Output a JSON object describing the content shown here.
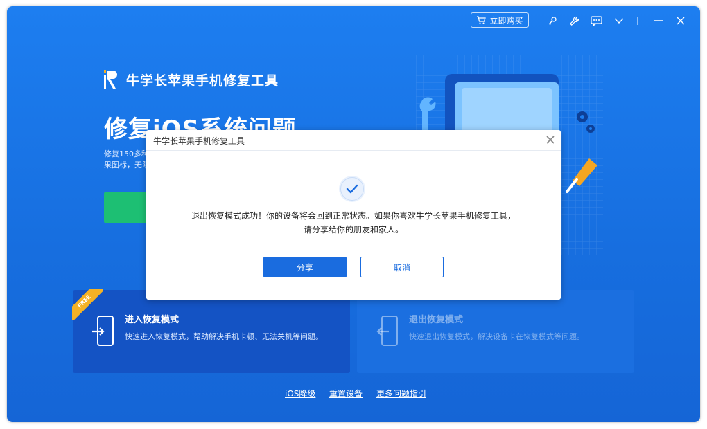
{
  "window": {
    "buy_button_label": "立即购买",
    "icons": [
      "key-icon",
      "wrench-icon",
      "feedback-icon",
      "chevron-down-icon",
      "minimize-icon",
      "close-icon"
    ]
  },
  "brand": {
    "name": "牛学长苹果手机修复工具",
    "logo_letter": "R"
  },
  "hero": {
    "title": "修复iOS系统问题",
    "desc_line1": "修复150多种",
    "desc_line2": "果图标，无限"
  },
  "cards": {
    "enter": {
      "badge": "FREE",
      "title": "进入恢复模式",
      "desc": "快速进入恢复模式，帮助解决手机卡顿、无法关机等问题。"
    },
    "exit": {
      "title": "退出恢复模式",
      "desc": "快速退出恢复模式，解决设备卡在恢复模式等问题。"
    }
  },
  "footer": {
    "links": [
      "iOS降级",
      "重置设备",
      "更多问题指引"
    ]
  },
  "dialog": {
    "title": "牛学长苹果手机修复工具",
    "message_line1": "退出恢复模式成功！你的设备将会回到正常状态。如果你喜欢牛学长苹果手机修复工具，",
    "message_line2": "请分享给你的朋友和家人。",
    "share_label": "分享",
    "cancel_label": "取消"
  },
  "colors": {
    "background": "#1d7ef0",
    "primary_button": "#1a6cdf",
    "success_green": "#1dbf73",
    "free_badge": "#f5b225"
  }
}
